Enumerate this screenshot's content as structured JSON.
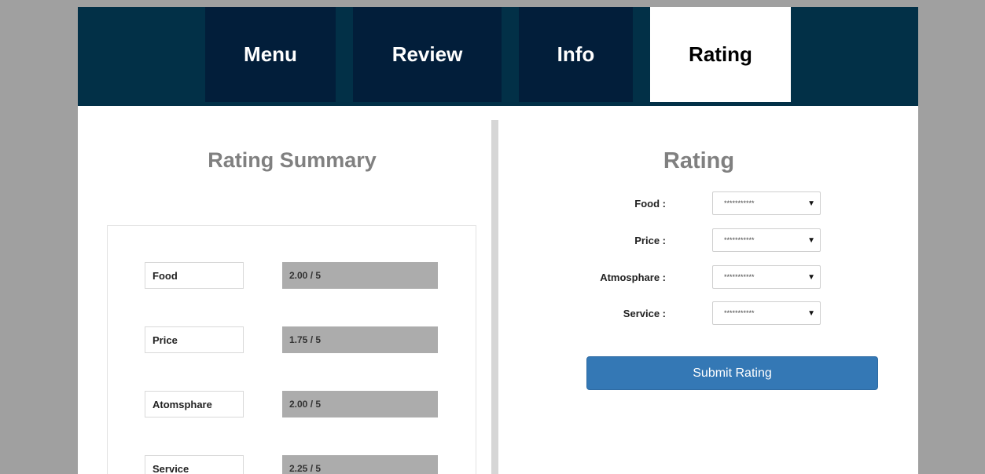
{
  "nav": {
    "tabs": [
      {
        "label": "Menu",
        "active": false
      },
      {
        "label": "Review",
        "active": false
      },
      {
        "label": "Info",
        "active": false
      },
      {
        "label": "Rating",
        "active": true
      }
    ]
  },
  "summary": {
    "title": "Rating Summary",
    "rows": [
      {
        "label": "Food",
        "value": "2.00 / 5"
      },
      {
        "label": "Price",
        "value": "1.75 / 5"
      },
      {
        "label": "Atomsphare",
        "value": "2.00 / 5"
      },
      {
        "label": "Service",
        "value": "2.25 / 5"
      }
    ]
  },
  "rating_form": {
    "title": "Rating",
    "fields": [
      {
        "label": "Food :",
        "selected": "***********"
      },
      {
        "label": "Price :",
        "selected": "***********"
      },
      {
        "label": "Atmosphare :",
        "selected": "***********"
      },
      {
        "label": "Service :",
        "selected": "***********"
      }
    ],
    "submit_label": "Submit Rating"
  },
  "colors": {
    "navbar": "#023047",
    "tab": "#021e3a",
    "submit": "#3478b5",
    "background": "#a0a0a0"
  }
}
